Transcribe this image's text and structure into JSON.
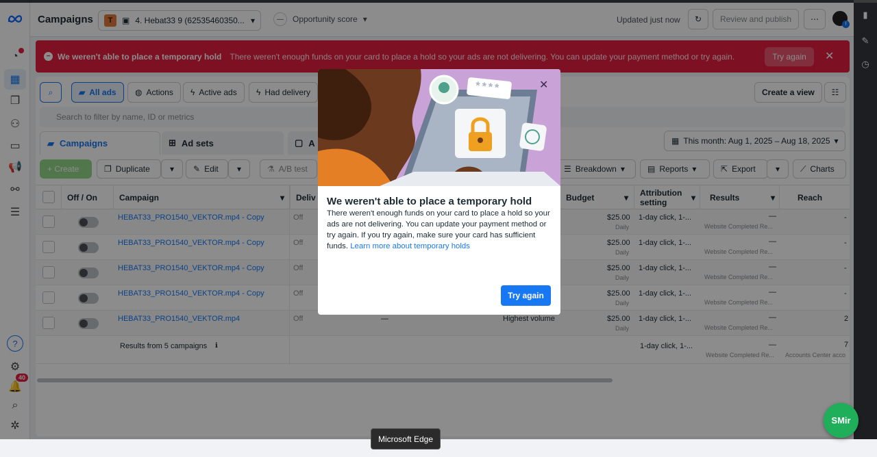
{
  "header": {
    "title": "Campaigns",
    "account_initial": "T",
    "account_name": "4. Hebat33 9 (62535460350...",
    "opportunity_label": "Opportunity score",
    "opportunity_value": "—",
    "updated": "Updated just now",
    "review_publish": "Review and publish",
    "more": "⋯"
  },
  "banner": {
    "title": "We weren't able to place a temporary hold",
    "message": "There weren't enough funds on your card to place a hold so your ads are not delivering. You can update your payment method or try again.",
    "try_again": "Try again"
  },
  "filters": {
    "all_ads": "All ads",
    "actions": "Actions",
    "active_ads": "Active ads",
    "had_delivery": "Had delivery",
    "create_view": "Create a view",
    "search_placeholder": "Search to filter by name, ID or metrics"
  },
  "tabs": {
    "campaigns": "Campaigns",
    "ad_sets": "Ad sets",
    "ads_partial": "A"
  },
  "date_range": "This month: Aug 1, 2025 – Aug 18, 2025",
  "toolbar": {
    "create": "+ Create",
    "duplicate": "Duplicate",
    "edit": "Edit",
    "ab_test": "A/B test",
    "breakdown": "Breakdown",
    "reports": "Reports",
    "export": "Export",
    "charts": "Charts"
  },
  "table": {
    "headers": {
      "offon": "Off / On",
      "campaign": "Campaign",
      "delivery": "Deliv",
      "budget": "Budget",
      "attribution": "Attribution setting",
      "results": "Results",
      "reach": "Reach"
    },
    "rows": [
      {
        "name": "HEBAT33_PRO1540_VEKTOR.mp4 - Copy",
        "delivery": "Off",
        "bid": "",
        "budget": "$25.00",
        "budget_type": "Daily",
        "attribution": "1-day click, 1-...",
        "results": "—",
        "results_sub": "Website Completed Re...",
        "reach": "-"
      },
      {
        "name": "HEBAT33_PRO1540_VEKTOR.mp4 - Copy",
        "delivery": "Off",
        "bid": "",
        "budget": "$25.00",
        "budget_type": "Daily",
        "attribution": "1-day click, 1-...",
        "results": "—",
        "results_sub": "Website Completed Re...",
        "reach": "-"
      },
      {
        "name": "HEBAT33_PRO1540_VEKTOR.mp4 - Copy",
        "delivery": "Off",
        "bid": "",
        "budget": "$25.00",
        "budget_type": "Daily",
        "attribution": "1-day click, 1-...",
        "results": "—",
        "results_sub": "Website Completed Re...",
        "reach": "-"
      },
      {
        "name": "HEBAT33_PRO1540_VEKTOR.mp4 - Copy",
        "delivery": "Off",
        "bid": "",
        "budget": "$25.00",
        "budget_type": "Daily",
        "attribution": "1-day click, 1-...",
        "results": "—",
        "results_sub": "Website Completed Re...",
        "reach": "-"
      },
      {
        "name": "HEBAT33_PRO1540_VEKTOR.mp4",
        "delivery": "Off",
        "bid": "Highest volume",
        "budget": "$25.00",
        "budget_type": "Daily",
        "attribution": "1-day click, 1-...",
        "results": "—",
        "results_sub": "Website Completed Re...",
        "reach": "2"
      }
    ],
    "summary": {
      "label": "Results from 5 campaigns",
      "attribution": "1-day click, 1-...",
      "results": "—",
      "results_sub": "Website Completed Re...",
      "reach_sub": "Accounts Center acco",
      "reach": "7"
    },
    "dash": "—"
  },
  "modal": {
    "title": "We weren't able to place a temporary hold",
    "body": "There weren't enough funds on your card to place a hold so your ads are not delivering. You can update your payment method or try again. If you try again, make sure your card has sufficient funds.",
    "link": "Learn more about temporary holds",
    "try_again": "Try again",
    "password_mask": "****"
  },
  "rail": {
    "notifications": "40",
    "help": "?"
  },
  "taskbar_tooltip": "Microsoft Edge",
  "smir": "SMir",
  "colors": {
    "accent": "#1877f2",
    "error": "#e41e3f",
    "create": "#42b72a"
  }
}
